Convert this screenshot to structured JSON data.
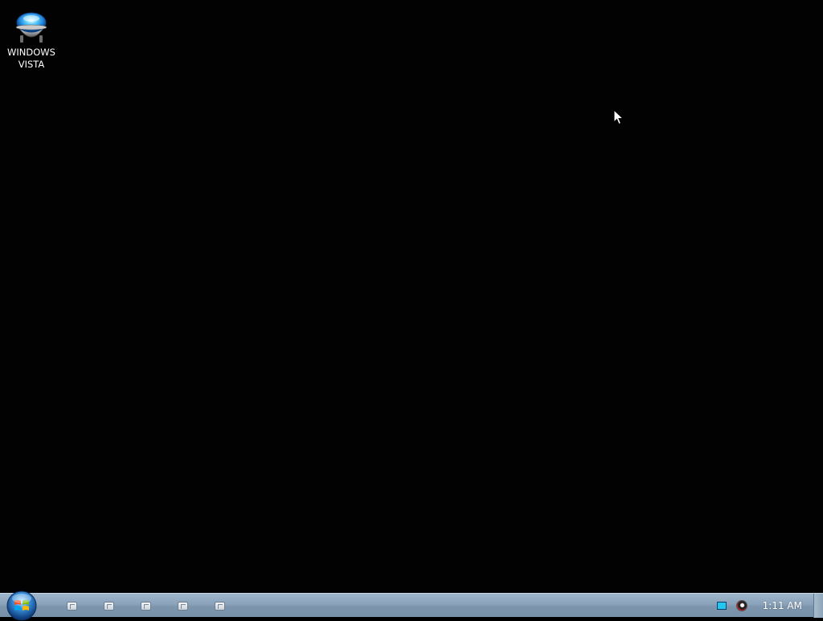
{
  "desktop": {
    "background_color": "#020202",
    "icons": [
      {
        "label": "WINDOWS VISTA",
        "icon": "vista-orb-icon"
      }
    ]
  },
  "taskbar": {
    "color": "#8aa3ba",
    "start_button": {
      "icon": "windows-orb-icon"
    },
    "pinned_items": [
      {
        "icon": "window-app-icon"
      },
      {
        "icon": "window-app-icon"
      },
      {
        "icon": "window-app-icon"
      },
      {
        "icon": "window-app-icon"
      },
      {
        "icon": "window-app-icon"
      }
    ],
    "tray": {
      "icons": [
        "network-icon",
        "volume-icon"
      ],
      "clock": "1:11 AM"
    }
  },
  "cursor": {
    "icon": "arrow-cursor-icon"
  }
}
